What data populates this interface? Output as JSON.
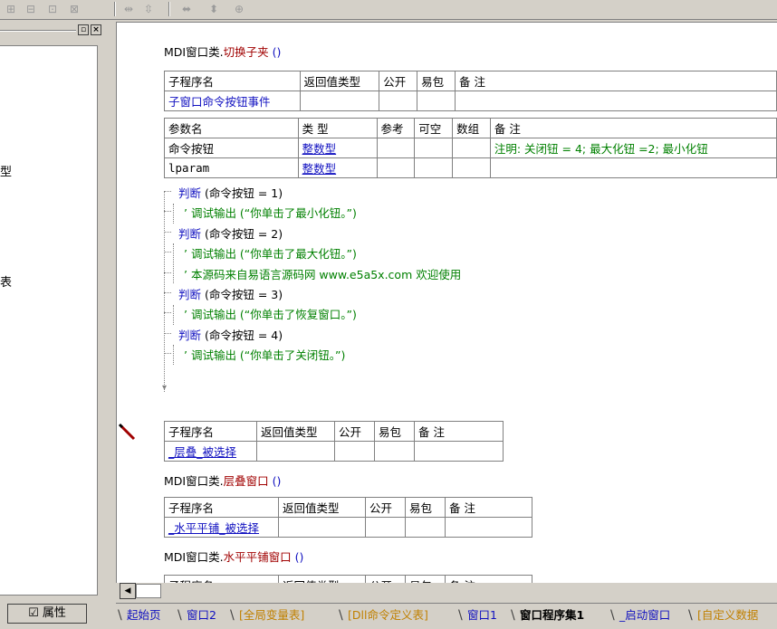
{
  "toolbar": {
    "icons": [
      "align-left-icon",
      "align-center-icon",
      "align-right-icon",
      "align-top-icon",
      "spacing-h-icon",
      "spacing-v-icon",
      "same-width-icon",
      "same-height-icon",
      "same-size-icon"
    ]
  },
  "left_panel": {
    "min_label": "▫",
    "close_label": "×",
    "fragment_1": "型",
    "fragment_2": "表"
  },
  "properties_tab": {
    "label": "属性"
  },
  "editor": {
    "block1": {
      "header": {
        "class": "MDI窗口类.",
        "method": "切换子夹",
        "parens": " ()"
      },
      "table_header": [
        "子程序名",
        "返回值类型",
        "公开",
        "易包",
        "备 注"
      ],
      "sub_name": "子窗口命令按钮事件",
      "param_header": [
        "参数名",
        "类 型",
        "参考",
        "可空",
        "数组",
        "备 注"
      ],
      "params": [
        {
          "name": "命令按钮",
          "type": "整数型",
          "note": "注明: 关闭钮 = 4; 最大化钮 =2; 最小化钮"
        },
        {
          "name": "lparam",
          "type": "整数型",
          "note": ""
        }
      ]
    },
    "code": [
      {
        "kw": "判断",
        "rest": " (命令按钮 = 1)",
        "type": "if"
      },
      {
        "kw": "’",
        "rest": " 调试输出 (“你单击了最小化钮。”)",
        "type": "cmt"
      },
      {
        "kw": "判断",
        "rest": " (命令按钮 = 2)",
        "type": "if"
      },
      {
        "kw": "’",
        "rest": " 调试输出 (“你单击了最大化钮。”)",
        "type": "cmt"
      },
      {
        "kw": "’",
        "rest": " 本源码来自易语言源码网 www.e5a5x.com  欢迎使用",
        "type": "cmt"
      },
      {
        "kw": "判断",
        "rest": " (命令按钮 = 3)",
        "type": "if"
      },
      {
        "kw": "’",
        "rest": " 调试输出 (“你单击了恢复窗口。”)",
        "type": "cmt"
      },
      {
        "kw": "判断",
        "rest": " (命令按钮 = 4)",
        "type": "if"
      },
      {
        "kw": "’",
        "rest": " 调试输出 (“你单击了关闭钮。”)",
        "type": "cmt"
      }
    ],
    "block2": {
      "table_header": [
        "子程序名",
        "返回值类型",
        "公开",
        "易包",
        "备 注"
      ],
      "sub_name": "_层叠_被选择",
      "header": {
        "class": "MDI窗口类.",
        "method": "层叠窗口",
        "parens": " ()"
      }
    },
    "block3": {
      "table_header": [
        "子程序名",
        "返回值类型",
        "公开",
        "易包",
        "备 注"
      ],
      "sub_name": "_水平平铺_被选择",
      "header": {
        "class": "MDI窗口类.",
        "method": "水平平铺窗口",
        "parens": " ()"
      }
    },
    "block4": {
      "table_header": [
        "子程序名",
        "返回值类型",
        "公开",
        "易包",
        "备 注"
      ]
    }
  },
  "tabs": [
    {
      "label": "起始页",
      "style": "blue"
    },
    {
      "label": "窗口2",
      "style": "blue"
    },
    {
      "label": "[全局变量表]",
      "style": "orange"
    },
    {
      "label": "[Dll命令定义表]",
      "style": "orange"
    },
    {
      "label": "窗口1",
      "style": "blue"
    },
    {
      "label": "窗口程序集1",
      "style": "active"
    },
    {
      "label": "_启动窗口",
      "style": "blue"
    },
    {
      "label": "[自定义数据",
      "style": "orange"
    }
  ],
  "colors": {
    "keyword": "#1010c0",
    "comment": "#008000",
    "method": "#a00000",
    "background": "#d4d0c8"
  }
}
